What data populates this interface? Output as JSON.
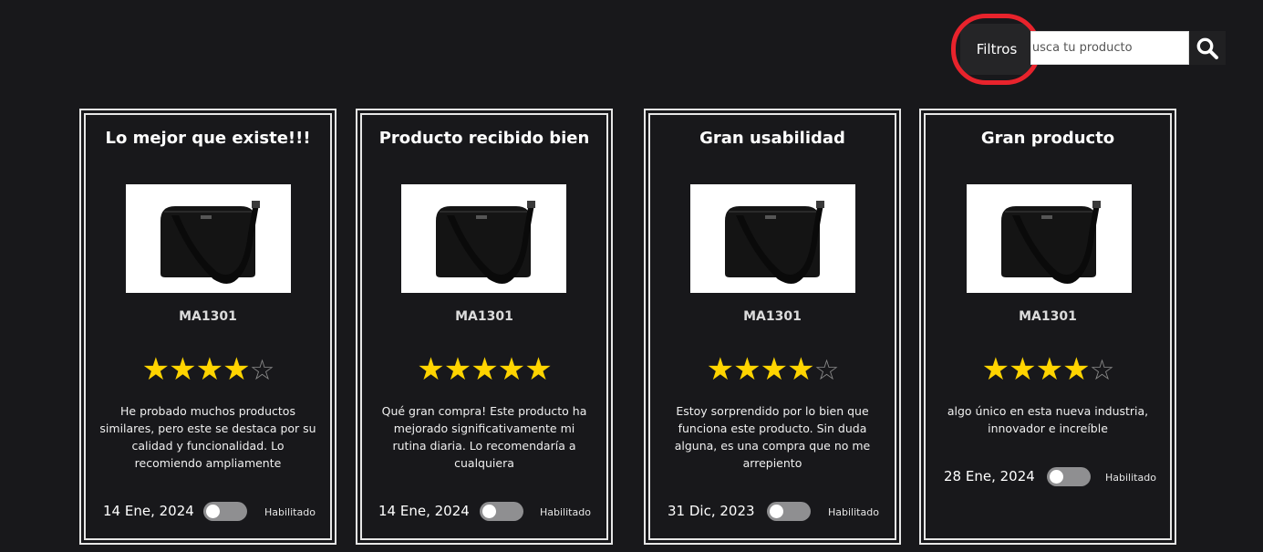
{
  "toolbar": {
    "filter_label": "Filtros",
    "search_placeholder": "Busca tu producto",
    "search_icon": "search-icon",
    "highlight_color": "#e8232c"
  },
  "colors": {
    "background": "#18181b",
    "star_filled": "#ffd400",
    "star_empty": "#8a8a8a",
    "toggle_track": "#8f8f91"
  },
  "cards": [
    {
      "title": "Lo mejor que existe!!!",
      "model": "MA1301",
      "rating": 4,
      "max_rating": 5,
      "review": "He probado muchos productos similares, pero este se destaca por su calidad y funcionalidad. Lo recomiendo ampliamente",
      "date": "14 Ene, 2024",
      "status": "Habilitado",
      "enabled": false
    },
    {
      "title": "Producto recibido bien",
      "model": "MA1301",
      "rating": 5,
      "max_rating": 5,
      "review": "Qué gran compra! Este producto ha mejorado significativamente mi rutina diaria. Lo recomendaría a cualquiera",
      "date": "14 Ene, 2024",
      "status": "Habilitado",
      "enabled": false
    },
    {
      "title": "Gran usabilidad",
      "model": "MA1301",
      "rating": 4,
      "max_rating": 5,
      "review": "Estoy sorprendido por lo bien que funciona este producto. Sin duda alguna, es una compra que no me arrepiento",
      "date": "31 Dic, 2023",
      "status": "Habilitado",
      "enabled": false
    },
    {
      "title": "Gran producto",
      "model": "MA1301",
      "rating": 4,
      "max_rating": 5,
      "review": "algo único en esta nueva industria, innovador e increíble",
      "date": "28 Ene, 2024",
      "status": "Habilitado",
      "enabled": false
    }
  ]
}
